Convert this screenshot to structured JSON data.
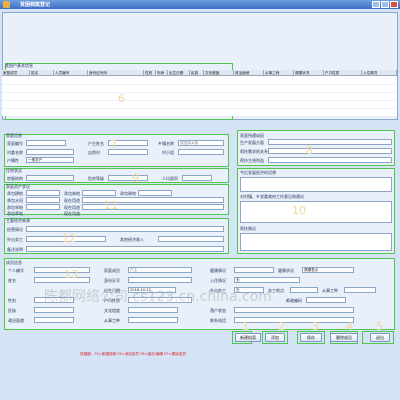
{
  "window": {
    "title": "贫困档案登记"
  },
  "list_panel": {
    "title": "贫困户基本信息",
    "columns": [
      "家庭成员",
      "姓名",
      "人员编号",
      "身份证号码",
      "性别",
      "年龄",
      "出生日期",
      "民族",
      "文化程度",
      "政治面貌",
      "从事工种",
      "健康状况",
      "户口性质",
      "入住情况"
    ],
    "marker": "6"
  },
  "family": {
    "title": "家庭信息",
    "household_no": "家庭编号",
    "household_name": "户主姓名",
    "town_label": "乡镇名称",
    "town_value": "请选择乡镇",
    "village_label": "村委名称",
    "village_select": "",
    "belong_label": "自然村",
    "group_label": "村小组",
    "type_label": "户属性",
    "type_value": "一般农户",
    "marker": "7"
  },
  "living": {
    "title": "住房状况",
    "housing_label": "房屋结构",
    "danger_label": "危房等级",
    "area_label": "人均面积",
    "marker": "9"
  },
  "land": {
    "title": "家庭资产状况",
    "rows": [
      {
        "l1": "承包耕地",
        "l2": "承包林地",
        "l3": "承包果地"
      },
      {
        "l1": "承包水田",
        "l2": "现在用途"
      },
      {
        "l1": "承包旱地",
        "l2": "现在用途"
      },
      {
        "l1": "承包草地",
        "l2": "现在用途"
      }
    ],
    "marker": "11"
  },
  "income": {
    "title": "主要经济来源",
    "ops_label": "经营情况",
    "work_label": "外出务工",
    "other_label": "其他经济收入",
    "note_label": "备注说明",
    "marker": "12"
  },
  "assist": {
    "title": "家庭所遭成因",
    "l1": "生产发展方面",
    "l2": "帮扶需求的关系",
    "l3": "帮扶主线利益",
    "marker": "8"
  },
  "plan": {
    "t1": "今后发展经济的设想",
    "t2": "对村镇、乡党委政府工作意见和建议",
    "t3": "帮扶情况",
    "marker": "10"
  },
  "member": {
    "title": "成员信息",
    "fields": {
      "person_no": "个人编号",
      "family_member": "家庭成员",
      "family_member_value": "户主",
      "health": "健康情况",
      "health_value": "健康状况",
      "health2": "健康表示",
      "name": "姓名",
      "id_no": "身份证号",
      "residence": "入住情况",
      "residence_value": "无",
      "birth": "出生日期",
      "birth_value": "2016-10-22",
      "out_work": "外出务工",
      "out_value": "无",
      "work_place": "务工地点",
      "gender": "性别",
      "hukou": "户口性质",
      "job": "从事工种",
      "mail": "邮政编码",
      "nation": "民族",
      "culture": "文化程度",
      "account": "落户状态",
      "politics": "政治面貌",
      "work_unit": "从事工种",
      "contact": "联系电话",
      "note": "备注"
    },
    "marker": "13"
  },
  "buttons": [
    {
      "label": "新建档案",
      "marker": "1"
    },
    {
      "label": "添加",
      "marker": "2"
    },
    {
      "label": "保存",
      "marker": "3"
    },
    {
      "label": "删除成员",
      "marker": "4"
    },
    {
      "label": "退出",
      "marker": "5"
    }
  ],
  "hint": "快捷键：F5=新建档案  F6=添加成员  F8=保存/编辑  F9=删除成员",
  "watermark": "陈都网络公司 cs123.cn.china.com"
}
